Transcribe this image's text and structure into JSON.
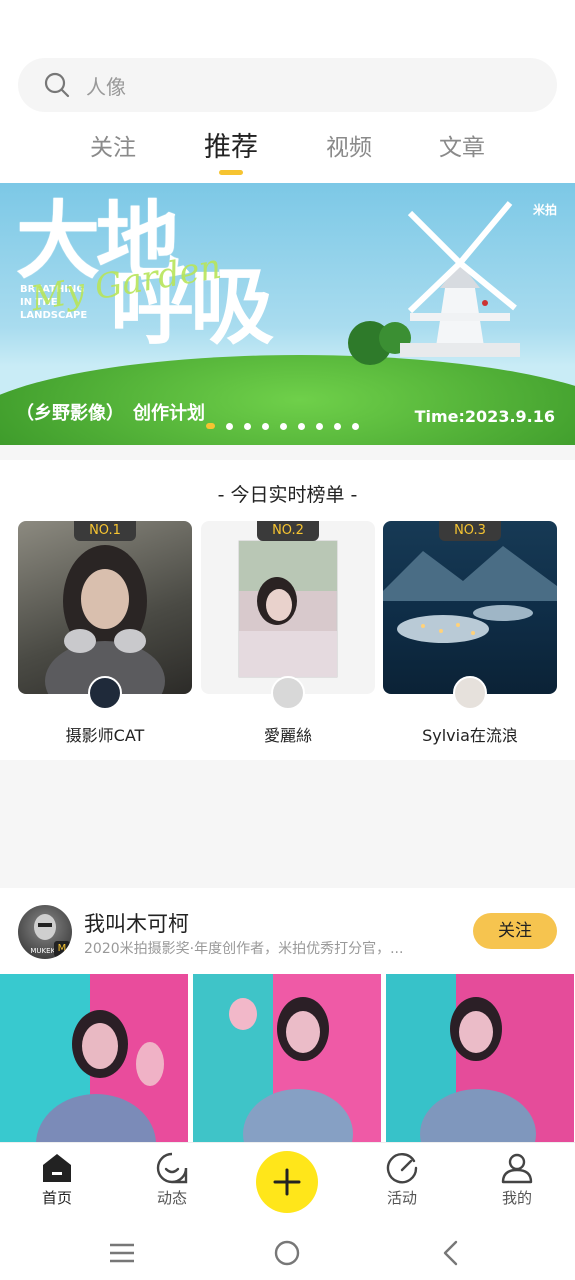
{
  "search": {
    "placeholder": "人像"
  },
  "tabs": [
    {
      "label": "关注"
    },
    {
      "label": "推荐"
    },
    {
      "label": "视频"
    },
    {
      "label": "文章"
    }
  ],
  "banner": {
    "title_line1": "大地",
    "title_line2": "呼吸",
    "english": "BREATHING IN THE LANDSCAPE",
    "script": "My Garden",
    "brands": "米拍",
    "caption": "（乡野影像）　创作计划",
    "time": "Time:2023.9.16",
    "slide_count": 9,
    "active_slide": 1
  },
  "ranking": {
    "title": "- 今日实时榜单 -",
    "items": [
      {
        "badge": "NO.1",
        "name": "摄影师CAT"
      },
      {
        "badge": "NO.2",
        "name": "愛麗絲"
      },
      {
        "badge": "NO.3",
        "name": "Sylvia在流浪"
      }
    ]
  },
  "post": {
    "author": "我叫木可柯",
    "avatar_text": "MUKEKE",
    "badge": "M",
    "description": "2020米拍摄影奖·年度创作者，米拍优秀打分官，...",
    "follow_label": "关注"
  },
  "nav": [
    {
      "label": "首页",
      "icon": "home-icon"
    },
    {
      "label": "动态",
      "icon": "feed-icon"
    },
    {
      "label": "",
      "icon": "plus-icon"
    },
    {
      "label": "活动",
      "icon": "activity-icon"
    },
    {
      "label": "我的",
      "icon": "profile-icon"
    }
  ],
  "colors": {
    "accent": "#f6c431",
    "fab": "#ffe61a",
    "follow": "#f6c44f"
  }
}
